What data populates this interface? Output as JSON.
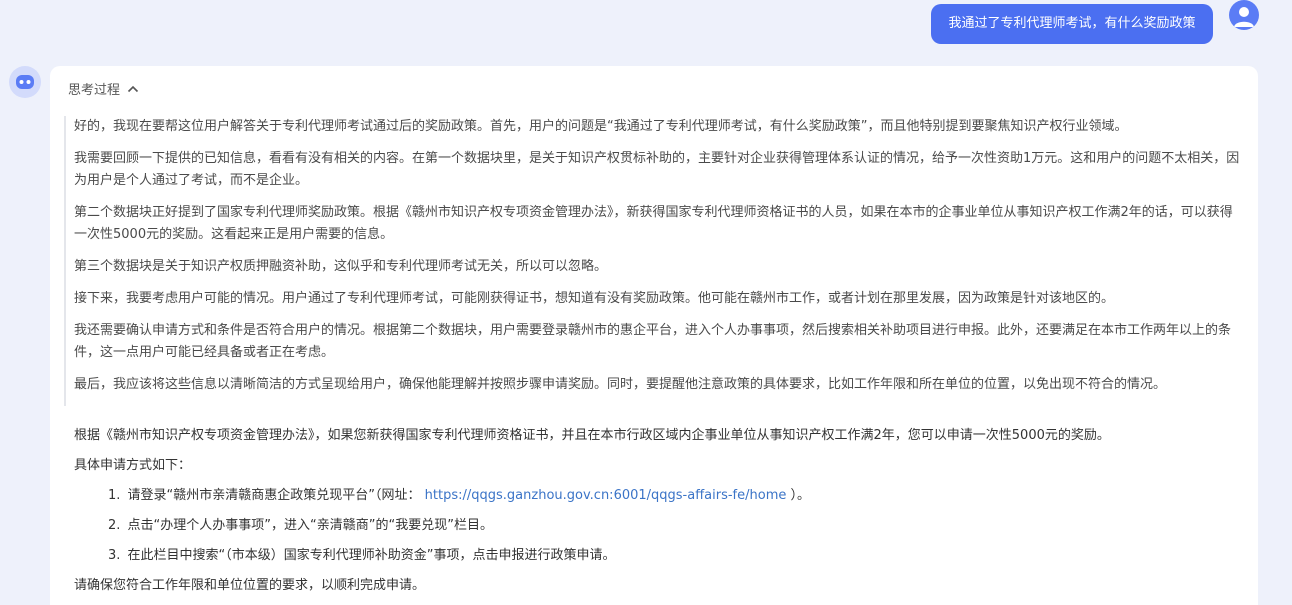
{
  "user_message": {
    "text": "我通过了专利代理师考试，有什么奖励政策"
  },
  "assistant": {
    "thinking_toggle_label": "思考过程",
    "thinking_paragraphs": [
      "好的，我现在要帮这位用户解答关于专利代理师考试通过后的奖励政策。首先，用户的问题是“我通过了专利代理师考试，有什么奖励政策”，而且他特别提到要聚焦知识产权行业领域。",
      "我需要回顾一下提供的已知信息，看看有没有相关的内容。在第一个数据块里，是关于知识产权贯标补助的，主要针对企业获得管理体系认证的情况，给予一次性资助1万元。这和用户的问题不太相关，因为用户是个人通过了考试，而不是企业。",
      "第二个数据块正好提到了国家专利代理师奖励政策。根据《赣州市知识产权专项资金管理办法》，新获得国家专利代理师资格证书的人员，如果在本市的企事业单位从事知识产权工作满2年的话，可以获得一次性5000元的奖励。这看起来正是用户需要的信息。",
      "第三个数据块是关于知识产权质押融资补助，这似乎和专利代理师考试无关，所以可以忽略。",
      "接下来，我要考虑用户可能的情况。用户通过了专利代理师考试，可能刚获得证书，想知道有没有奖励政策。他可能在赣州市工作，或者计划在那里发展，因为政策是针对该地区的。",
      "我还需要确认申请方式和条件是否符合用户的情况。根据第二个数据块，用户需要登录赣州市的惠企平台，进入个人办事事项，然后搜索相关补助项目进行申报。此外，还要满足在本市工作两年以上的条件，这一点用户可能已经具备或者正在考虑。",
      "最后，我应该将这些信息以清晰简洁的方式呈现给用户，确保他能理解并按照步骤申请奖励。同时，要提醒他注意政策的具体要求，比如工作年限和所在单位的位置，以免出现不符合的情况。"
    ],
    "answer": {
      "intro": "根据《赣州市知识产权专项资金管理办法》，如果您新获得国家专利代理师资格证书，并且在本市行政区域内企事业单位从事知识产权工作满2年，您可以申请一次性5000元的奖励。",
      "method_heading": "具体申请方式如下：",
      "steps": [
        {
          "num": "1.",
          "before": "请登录“赣州市亲清赣商惠企政策兑现平台”（网址：",
          "link": "https://qqgs.ganzhou.gov.cn:6001/qqgs-affairs-fe/home",
          "after": "）。"
        },
        {
          "num": "2.",
          "before": "点击“办理个人办事事项”，进入“亲清赣商”的“我要兑现”栏目。",
          "link": "",
          "after": ""
        },
        {
          "num": "3.",
          "before": "在此栏目中搜索“（市本级）国家专利代理师补助资金”事项，点击申报进行政策申请。",
          "link": "",
          "after": ""
        }
      ],
      "closing": "请确保您符合工作年限和单位位置的要求，以顺利完成申请。"
    }
  },
  "colors": {
    "user_bubble": "#4b6ff1",
    "link": "#3b74c7",
    "background": "#eef1fb"
  },
  "icons": {
    "user_avatar": "person-icon",
    "bot_avatar": "robot-icon",
    "toggle": "chevron-up-icon"
  }
}
